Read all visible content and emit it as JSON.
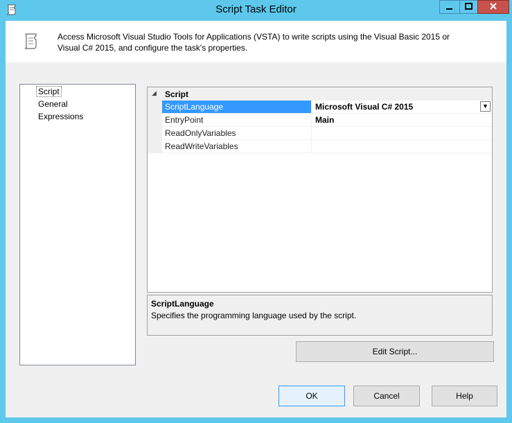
{
  "window": {
    "title": "Script Task Editor",
    "minimize_icon": "minimize-icon",
    "maximize_icon": "maximize-icon",
    "close_icon": "close-icon"
  },
  "header": {
    "icon": "script-scroll-icon",
    "description": "Access Microsoft Visual Studio Tools for Applications (VSTA) to write scripts using the Visual Basic 2015 or Visual C# 2015, and configure the task's properties."
  },
  "nav": {
    "items": [
      {
        "label": "Script",
        "selected": true
      },
      {
        "label": "General",
        "selected": false
      },
      {
        "label": "Expressions",
        "selected": false
      }
    ]
  },
  "grid": {
    "category": "Script",
    "collapse_glyph": "◢",
    "dropdown_glyph": "▼",
    "rows": [
      {
        "name": "ScriptLanguage",
        "value": "Microsoft Visual C# 2015",
        "selected": true
      },
      {
        "name": "EntryPoint",
        "value": "Main",
        "selected": false
      },
      {
        "name": "ReadOnlyVariables",
        "value": "",
        "selected": false
      },
      {
        "name": "ReadWriteVariables",
        "value": "",
        "selected": false
      }
    ]
  },
  "description": {
    "title": "ScriptLanguage",
    "text": "Specifies the programming language used by the script."
  },
  "buttons": {
    "edit_script": "Edit Script...",
    "ok": "OK",
    "cancel": "Cancel",
    "help": "Help"
  },
  "colors": {
    "chrome": "#5ec8ec",
    "selection": "#3399ff",
    "close": "#c7514b"
  }
}
